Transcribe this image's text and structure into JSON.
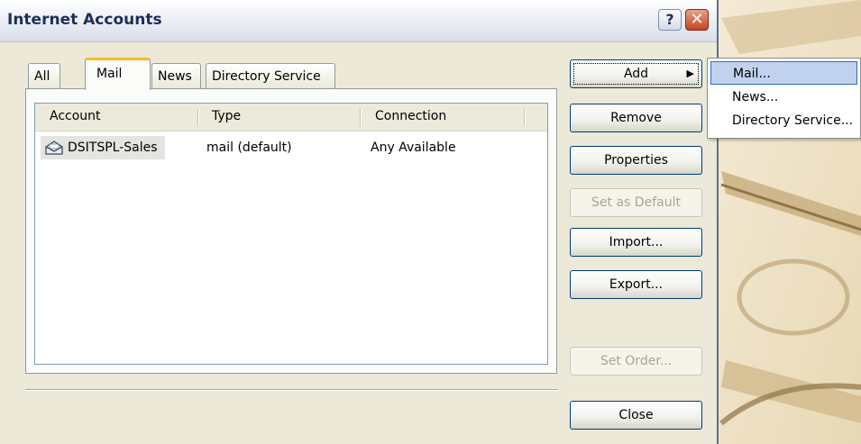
{
  "window": {
    "title": "Internet Accounts",
    "help_glyph": "?",
    "close_glyph": "✕"
  },
  "tabs": [
    {
      "label": "All"
    },
    {
      "label": "Mail"
    },
    {
      "label": "News"
    },
    {
      "label": "Directory Service"
    }
  ],
  "selected_tab": "Mail",
  "list": {
    "columns": [
      "Account",
      "Type",
      "Connection"
    ],
    "rows": [
      {
        "account": "DSITSPL-Sales",
        "type": "mail (default)",
        "connection": "Any Available"
      }
    ]
  },
  "buttons": {
    "add": "Add",
    "add_arrow": "▶",
    "remove": "Remove",
    "properties": "Properties",
    "set_default": "Set as Default",
    "import": "Import...",
    "export": "Export...",
    "set_order": "Set Order...",
    "close": "Close"
  },
  "add_menu": {
    "items": [
      "Mail...",
      "News...",
      "Directory Service..."
    ]
  },
  "colors": {
    "dialog_bg": "#ece9d8",
    "selected_tab_accent": "#f7b82a",
    "menu_highlight": "#c1d2ee",
    "close_button": "#c4441f"
  },
  "icons": {
    "account_icon": "mail-account-icon",
    "add_arrow_icon": "triangle-right-icon"
  }
}
